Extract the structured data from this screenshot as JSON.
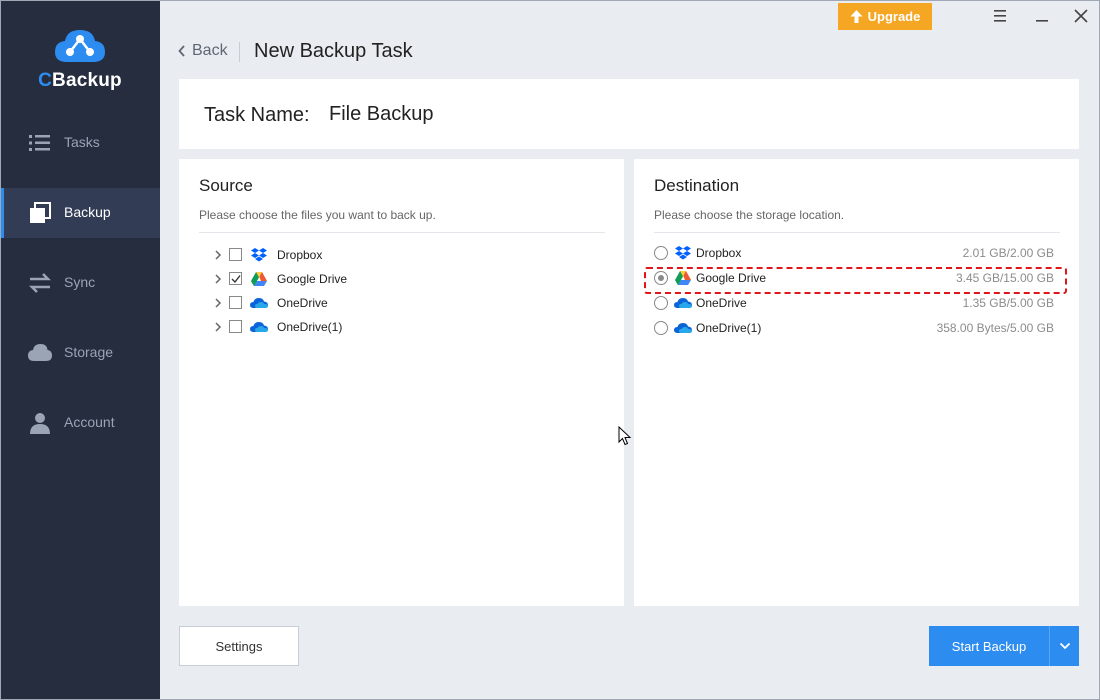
{
  "app": {
    "name_prefix": "C",
    "name_rest": "Backup"
  },
  "sidebar": {
    "items": [
      {
        "label": "Tasks",
        "icon": "list-icon"
      },
      {
        "label": "Backup",
        "icon": "backup-icon",
        "active": true
      },
      {
        "label": "Sync",
        "icon": "sync-arrows-icon"
      },
      {
        "label": "Storage",
        "icon": "cloud-icon"
      },
      {
        "label": "Account",
        "icon": "user-icon"
      }
    ]
  },
  "window": {
    "upgrade_label": "Upgrade"
  },
  "header": {
    "back_label": "Back",
    "title": "New Backup Task"
  },
  "task": {
    "label": "Task Name:",
    "value": "File Backup"
  },
  "source": {
    "title": "Source",
    "subtitle": "Please choose the files you want to back up.",
    "items": [
      {
        "name": "Dropbox",
        "checked": false,
        "icon": "dropbox-icon"
      },
      {
        "name": "Google Drive",
        "checked": true,
        "icon": "google-drive-icon"
      },
      {
        "name": "OneDrive",
        "checked": false,
        "icon": "onedrive-icon"
      },
      {
        "name": "OneDrive(1)",
        "checked": false,
        "icon": "onedrive-icon"
      }
    ]
  },
  "destination": {
    "title": "Destination",
    "subtitle": "Please choose the storage location.",
    "items": [
      {
        "name": "Dropbox",
        "size": "2.01 GB/2.00 GB",
        "selected": false,
        "icon": "dropbox-icon"
      },
      {
        "name": "Google Drive",
        "size": "3.45 GB/15.00 GB",
        "selected": true,
        "icon": "google-drive-icon"
      },
      {
        "name": "OneDrive",
        "size": "1.35 GB/5.00 GB",
        "selected": false,
        "icon": "onedrive-icon"
      },
      {
        "name": "OneDrive(1)",
        "size": "358.00 Bytes/5.00 GB",
        "selected": false,
        "icon": "onedrive-icon"
      }
    ]
  },
  "footer": {
    "settings_label": "Settings",
    "start_label": "Start Backup"
  },
  "colors": {
    "accent": "#2d8cf0",
    "sidebar": "#252d3f",
    "upgrade": "#f5a623",
    "highlight": "#e0161b"
  }
}
